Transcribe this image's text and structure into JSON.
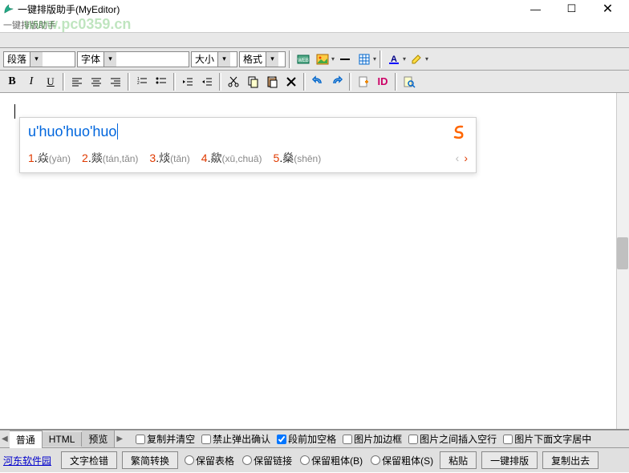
{
  "window": {
    "title": "一键排版助手(MyEditor)",
    "subtitle": "一键排版助手"
  },
  "watermark": "www.pc0359.cn",
  "toolbar1": {
    "para": "段落",
    "font": "字体",
    "size": "大小",
    "format": "格式"
  },
  "ime": {
    "input": "u'huo'huo'huo",
    "candidates": [
      {
        "n": "1",
        "ch": "焱",
        "py": "(yàn)"
      },
      {
        "n": "2",
        "ch": "燚",
        "py": "(tán,tǎn)"
      },
      {
        "n": "3",
        "ch": "㷋",
        "py": "(tǎn)"
      },
      {
        "n": "4",
        "ch": "歘",
        "py": "(xū,chuā)"
      },
      {
        "n": "5",
        "ch": "燊",
        "py": "(shēn)"
      }
    ]
  },
  "tabs": {
    "normal": "普通",
    "html": "HTML",
    "preview": "预览"
  },
  "opts": {
    "copy_clear": "复制并清空",
    "no_popup": "禁止弹出确认",
    "space_before": "段前加空格",
    "img_border": "图片加边框",
    "img_blank": "图片之间插入空行",
    "img_center": "图片下面文字居中"
  },
  "actions": {
    "site": "河东软件园",
    "spellcheck": "文字检错",
    "convert": "繁简转换",
    "keep_table": "保留表格",
    "keep_link": "保留链接",
    "keep_bold_b": "保留粗体(B)",
    "keep_bold_s": "保留粗体(S)",
    "paste": "粘贴",
    "format_btn": "一键排版",
    "copy_out": "复制出去"
  }
}
